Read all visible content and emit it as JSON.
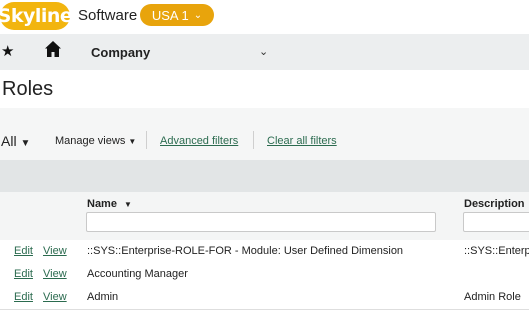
{
  "header": {
    "logo_text": "Skyline",
    "brand_text": "Software",
    "region_label": "USA 1",
    "logo_color": "#f2b50f",
    "region_color": "#e8a40c"
  },
  "nav": {
    "favorites_icon": "star-icon",
    "home_icon": "home-icon",
    "menu_label": "Company"
  },
  "page": {
    "title": "Roles"
  },
  "toolbar": {
    "all_label": "All",
    "manage_views_label": "Manage views",
    "advanced_filters_label": "Advanced filters",
    "clear_filters_label": "Clear all filters",
    "link_color": "#2b6b4f"
  },
  "grid": {
    "columns": [
      {
        "label": "Name",
        "sorted": "descending"
      },
      {
        "label": "Description"
      }
    ],
    "rows": [
      {
        "edit": "Edit",
        "view": "View",
        "name": "::SYS::Enterprise-ROLE-FOR - Module: User Defined Dimension",
        "description": "::SYS::Enterprise"
      },
      {
        "edit": "Edit",
        "view": "View",
        "name": "Accounting Manager",
        "description": ""
      },
      {
        "edit": "Edit",
        "view": "View",
        "name": "Admin",
        "description": "Admin Role"
      }
    ]
  }
}
